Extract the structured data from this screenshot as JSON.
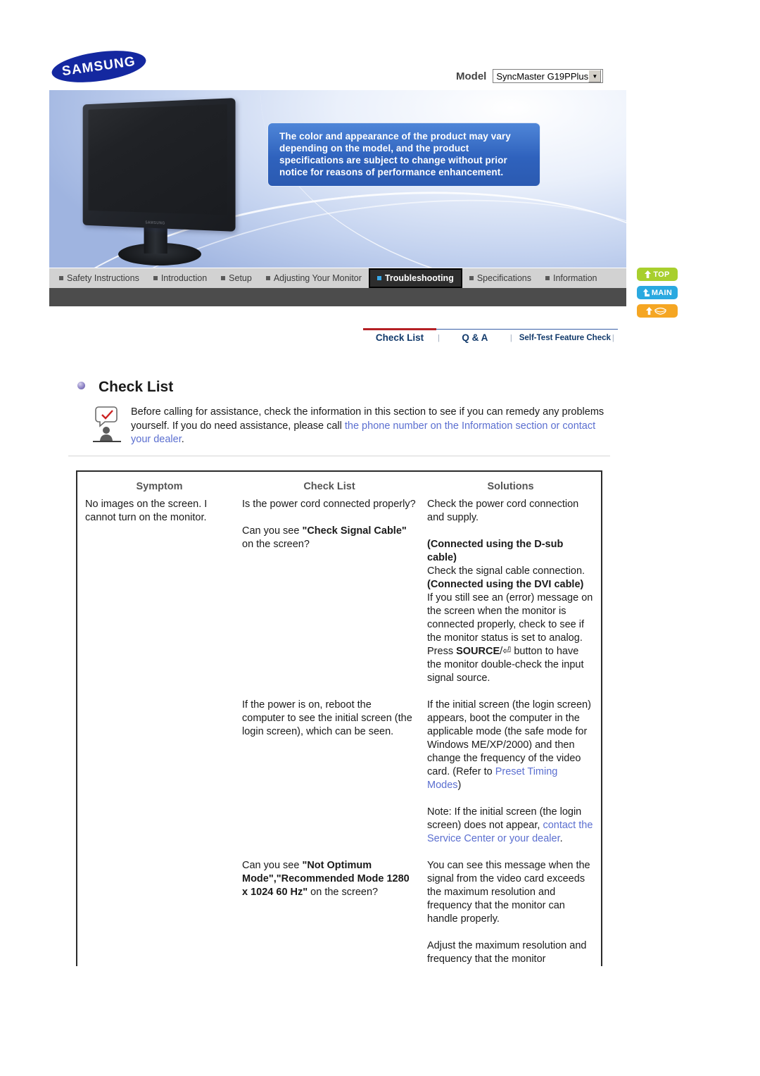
{
  "header": {
    "logo_text": "SAMSUNG",
    "model_label": "Model",
    "model_value": "SyncMaster G19PPlus",
    "dropdown_arrow": "▼",
    "notice_text": "The color and appearance of the product may vary depending on the model, and the product specifications are subject to change without prior notice for reasons of performance enhancement.",
    "monitor_brand": "SAMSUNG"
  },
  "nav": {
    "items": [
      {
        "label": "Safety Instructions",
        "active": false
      },
      {
        "label": "Introduction",
        "active": false
      },
      {
        "label": "Setup",
        "active": false
      },
      {
        "label": "Adjusting Your Monitor",
        "active": false
      },
      {
        "label": "Troubleshooting",
        "active": true
      },
      {
        "label": "Specifications",
        "active": false
      },
      {
        "label": "Information",
        "active": false
      }
    ]
  },
  "side_buttons": [
    {
      "label": "TOP",
      "icon": "arrow-up-icon",
      "color": "#a8cf2e"
    },
    {
      "label": "MAIN",
      "icon": "arrow-turn-icon",
      "color": "#2aa9e0"
    },
    {
      "label": "",
      "icon": "mail-icon",
      "color": "#f5a623"
    }
  ],
  "subtabs": [
    {
      "label": "Check List",
      "active": true
    },
    {
      "label": "Q & A",
      "active": false
    },
    {
      "label": "Self-Test Feature Check",
      "active": false
    }
  ],
  "section": {
    "title": "Check List",
    "intro_1": "Before calling for assistance, check the information in this section to see if you can remedy any problems yourself. If you do need assistance, please call ",
    "intro_link": "the phone number on the Information section or contact your dealer",
    "intro_end": "."
  },
  "table": {
    "headers": [
      "Symptom",
      "Check List",
      "Solutions"
    ],
    "rows": [
      {
        "symptom": "No images on the screen. I cannot turn on the monitor.",
        "checklist_1": "Is the power cord connected properly?",
        "checklist_2_pre": "Can you see ",
        "checklist_2_bold": "\"Check Signal Cable\"",
        "checklist_2_post": " on the screen?",
        "solution_1": "Check the power cord connection and supply.",
        "solution_2_bold": "(Connected using the D-sub cable)",
        "solution_2_text": "Check the signal cable connection.",
        "solution_3_bold": "(Connected using the DVI cable)",
        "solution_3_text_a": "If you still see an (error) message on the screen when the monitor is connected properly, check to see if the monitor status is set to analog. Press ",
        "solution_3_bold_b": "SOURCE",
        "solution_3_glyph": "/⏎",
        "solution_3_text_b": " button to have the monitor double-check the input signal source."
      },
      {
        "checklist": "If the power is on, reboot the computer to see the initial screen (the login screen), which can be seen.",
        "solution_a": "If the initial screen (the login screen) appears, boot the computer in the applicable mode (the safe mode for Windows ME/XP/2000) and then change the frequency of the video card. (Refer to ",
        "solution_a_link": "Preset Timing Modes",
        "solution_a_end": ")",
        "solution_b": "Note: If the initial screen (the login screen) does not appear, ",
        "solution_b_link": "contact the Service Center or your dealer",
        "solution_b_end": "."
      },
      {
        "checklist_pre": "Can you see ",
        "checklist_bold": "\"Not Optimum Mode\",\"Recommended Mode 1280 x 1024 60 Hz\"",
        "checklist_post": " on the screen?",
        "solution_a": "You can see this message when the signal from the video card exceeds the maximum resolution and frequency that the monitor can handle properly.",
        "solution_b": "Adjust the maximum resolution and frequency that the monitor"
      }
    ]
  }
}
